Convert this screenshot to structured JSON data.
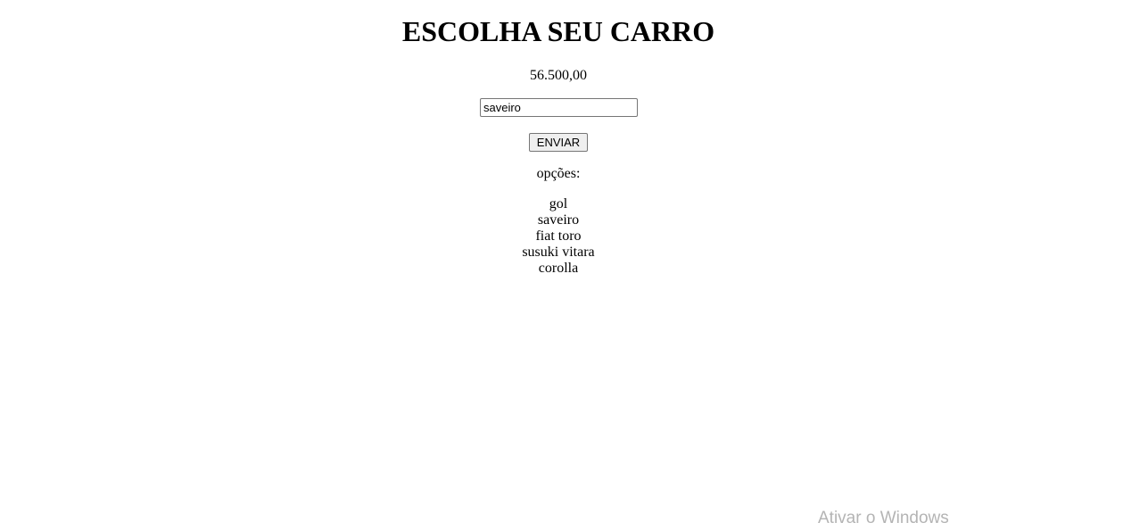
{
  "page": {
    "title": "ESCOLHA SEU CARRO",
    "price": "56.500,00"
  },
  "form": {
    "car_input_value": "saveiro",
    "send_label": "ENVIAR"
  },
  "options": {
    "label": "opções:",
    "items": [
      "gol",
      "saveiro",
      "fiat toro",
      "susuki vitara",
      "corolla"
    ]
  },
  "watermark": {
    "text": "Ativar o Windows"
  }
}
